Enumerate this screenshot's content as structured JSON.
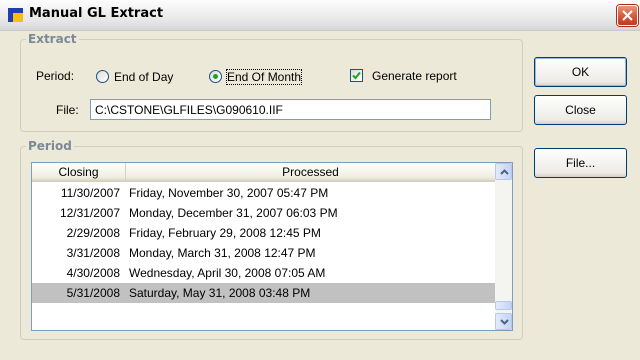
{
  "window": {
    "title": "Manual GL Extract"
  },
  "extract": {
    "legend": "Extract",
    "period_label": "Period:",
    "options": [
      {
        "label": "End of Day",
        "selected": false
      },
      {
        "label": "End Of Month",
        "selected": true
      }
    ],
    "generate_report": {
      "label": "Generate report",
      "checked": true
    },
    "file_label": "File:",
    "file_value": "C:\\CSTONE\\GLFILES\\G090610.IIF"
  },
  "period": {
    "legend": "Period",
    "columns": [
      "Closing",
      "Processed"
    ],
    "rows": [
      {
        "closing": "11/30/2007",
        "processed": "Friday, November 30, 2007 05:47 PM"
      },
      {
        "closing": "12/31/2007",
        "processed": "Monday, December 31, 2007 06:03 PM"
      },
      {
        "closing": "2/29/2008",
        "processed": "Friday, February 29, 2008 12:45 PM"
      },
      {
        "closing": "3/31/2008",
        "processed": "Monday, March 31, 2008 12:47 PM"
      },
      {
        "closing": "4/30/2008",
        "processed": "Wednesday, April 30, 2008 07:05 AM"
      },
      {
        "closing": "5/31/2008",
        "processed": "Saturday, May 31, 2008 03:48 PM",
        "selected": true
      }
    ]
  },
  "buttons": {
    "ok": "OK",
    "close": "Close",
    "file": "File..."
  },
  "colors": {
    "selection": "#c1c1c1",
    "legend_text": "#7a8a99",
    "radio_dot": "#21a121"
  },
  "icons": [
    "app-icon",
    "close-icon",
    "checkmark-icon",
    "scroll-up-icon",
    "scroll-down-icon"
  ]
}
